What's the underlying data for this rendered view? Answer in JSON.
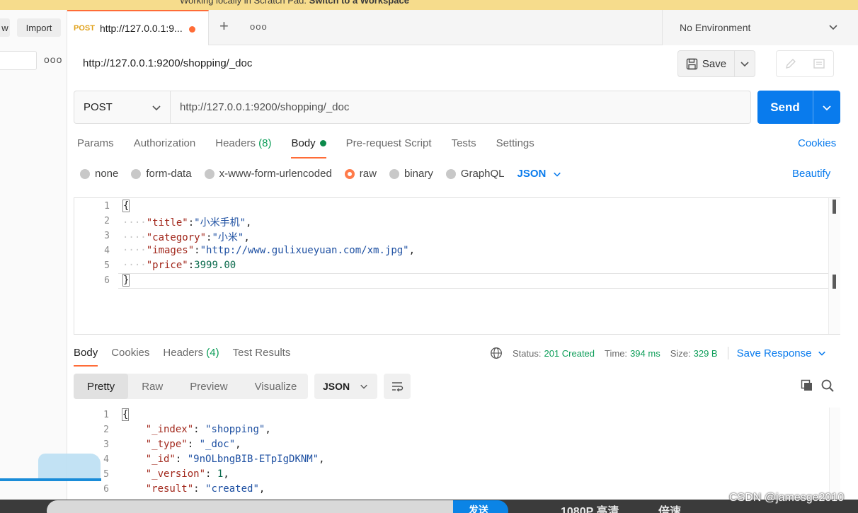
{
  "banner": {
    "text": "Working locally in Scratch Pad.",
    "link": "Switch to a Workspace"
  },
  "sidebar": {
    "new_label": "w",
    "import_label": "Import"
  },
  "tab": {
    "method": "POST",
    "title": "http://127.0.0.1:9..."
  },
  "environment": {
    "label": "No Environment"
  },
  "request": {
    "name": "http://127.0.0.1:9200/shopping/_doc",
    "save_label": "Save",
    "method": "POST",
    "url": "http://127.0.0.1:9200/shopping/_doc",
    "send_label": "Send",
    "tabs": [
      {
        "label": "Params"
      },
      {
        "label": "Authorization"
      },
      {
        "label": "Headers",
        "count": "(8)"
      },
      {
        "label": "Body"
      },
      {
        "label": "Pre-request Script"
      },
      {
        "label": "Tests"
      },
      {
        "label": "Settings"
      }
    ],
    "cookies_label": "Cookies",
    "body_types": [
      "none",
      "form-data",
      "x-www-form-urlencoded",
      "raw",
      "binary",
      "GraphQL"
    ],
    "body_format": "JSON",
    "beautify_label": "Beautify",
    "lines": [
      "1",
      "2",
      "3",
      "4",
      "5",
      "6"
    ],
    "body": {
      "open": "{",
      "title_key": "\"title\"",
      "title_val": "\"小米手机\"",
      "category_key": "\"category\"",
      "category_val": "\"小米\"",
      "images_key": "\"images\"",
      "images_val": "\"http://www.gulixueyuan.com/xm.jpg\"",
      "price_key": "\"price\"",
      "price_val": "3999.00",
      "close": "}"
    }
  },
  "response": {
    "tabs": [
      {
        "label": "Body"
      },
      {
        "label": "Cookies"
      },
      {
        "label": "Headers",
        "count": "(4)"
      },
      {
        "label": "Test Results"
      }
    ],
    "status_label": "Status:",
    "status_value": "201 Created",
    "time_label": "Time:",
    "time_value": "394 ms",
    "size_label": "Size:",
    "size_value": "329 B",
    "save_response_label": "Save Response",
    "views": [
      "Pretty",
      "Raw",
      "Preview",
      "Visualize"
    ],
    "format": "JSON",
    "lines": [
      "1",
      "2",
      "3",
      "4",
      "5",
      "6"
    ],
    "body": {
      "open": "{",
      "index_key": "\"_index\"",
      "index_val": "\"shopping\"",
      "type_key": "\"_type\"",
      "type_val": "\"_doc\"",
      "id_key": "\"_id\"",
      "id_val": "\"9nOLbngBIB-ETpIgDKNM\"",
      "version_key": "\"_version\"",
      "version_val": "1",
      "result_key": "\"result\"",
      "result_val": "\"created\""
    }
  },
  "player": {
    "send_label": "发送",
    "quality": "1080P 高清",
    "speed": "倍速"
  },
  "watermark": "CSDN @jamesge2010",
  "colors": {
    "accent": "#ff6c37",
    "brand_blue": "#097bed",
    "status_green": "#0c9d58"
  }
}
